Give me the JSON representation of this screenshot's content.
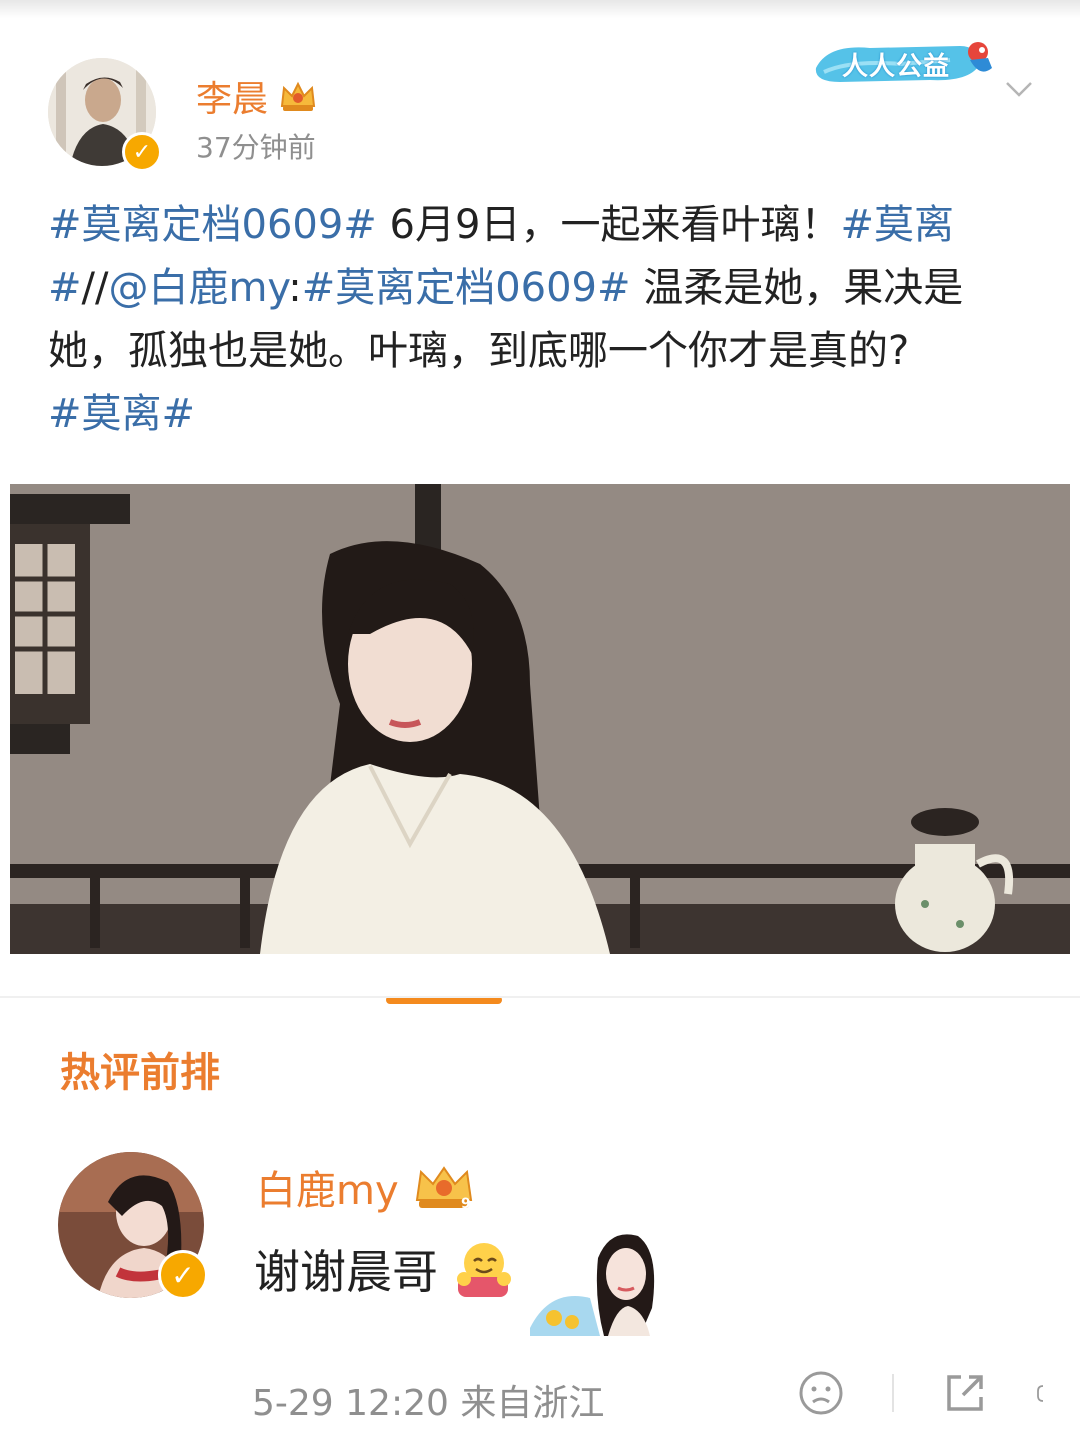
{
  "post": {
    "author": "李晨",
    "time": "37分钟前",
    "charity_badge": "人人公益",
    "content": {
      "tag1": "#莫离定档0609#",
      "text1": " 6月9日，一起来看叶璃！",
      "tag2": "#莫离#",
      "repost_prefix": "//",
      "mention": "@白鹿my",
      "colon": ":",
      "tag3": "#莫离定档0609#",
      "text2": " 温柔是她，果决是她，孤独也是她。叶璃，到底哪一个你才是真的?",
      "tag4": "#莫离#"
    }
  },
  "hot_comments": {
    "title": "热评前排",
    "comment": {
      "author": "白鹿my",
      "crown_level": "9",
      "text": "谢谢晨哥",
      "date": "5-29 12:20",
      "location": "来自浙江"
    }
  },
  "colors": {
    "accent": "#eb7d2f",
    "topic_link": "#3a6ea8",
    "meta_text": "#8f8f8f",
    "verified": "#f7a800"
  }
}
